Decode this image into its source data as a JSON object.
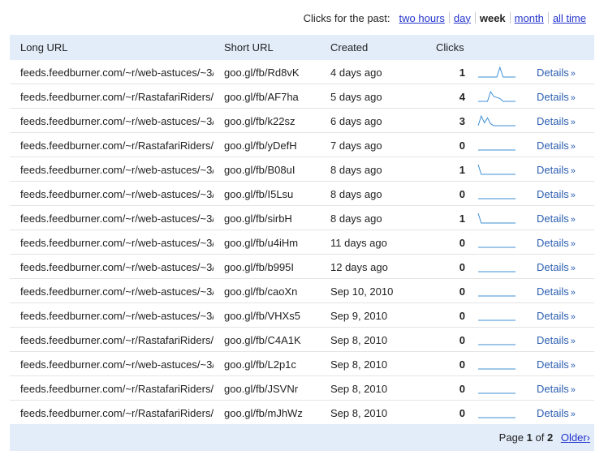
{
  "period": {
    "label": "Clicks for the past:",
    "options": [
      "two hours",
      "day",
      "week",
      "month",
      "all time"
    ],
    "selected": "week"
  },
  "columns": {
    "long_url": "Long URL",
    "short_url": "Short URL",
    "created": "Created",
    "clicks": "Clicks"
  },
  "colors": {
    "header_bg": "#e3ecf9",
    "link": "#2a5db0",
    "sparkline": "#3d8fd6"
  },
  "rows": [
    {
      "long": "feeds.feedburner.com/~r/web-astuces/~3/",
      "short": "goo.gl/fb/Rd8vK",
      "created": "4 days ago",
      "clicks": "1",
      "details": "Details",
      "spark": [
        0,
        0,
        0,
        0,
        0,
        0,
        0,
        1,
        0,
        0,
        0,
        0,
        0
      ]
    },
    {
      "long": "feeds.feedburner.com/~r/RastafariRiders/~3/",
      "short": "goo.gl/fb/AF7ha",
      "created": "5 days ago",
      "clicks": "4",
      "details": "Details",
      "spark": [
        0,
        0,
        0,
        0,
        1,
        0.5,
        0.4,
        0.3,
        0,
        0,
        0,
        0,
        0
      ]
    },
    {
      "long": "feeds.feedburner.com/~r/web-astuces/~3/",
      "short": "goo.gl/fb/k22sz",
      "created": "6 days ago",
      "clicks": "3",
      "details": "Details",
      "spark": [
        0,
        1,
        0.3,
        0.8,
        0.2,
        0,
        0,
        0,
        0,
        0,
        0,
        0,
        0
      ]
    },
    {
      "long": "feeds.feedburner.com/~r/RastafariRiders/~3/",
      "short": "goo.gl/fb/yDefH",
      "created": "7 days ago",
      "clicks": "0",
      "details": "Details",
      "spark": [
        0,
        0,
        0,
        0,
        0,
        0,
        0,
        0,
        0,
        0,
        0,
        0,
        0
      ]
    },
    {
      "long": "feeds.feedburner.com/~r/web-astuces/~3/",
      "short": "goo.gl/fb/B08uI",
      "created": "8 days ago",
      "clicks": "1",
      "details": "Details",
      "spark": [
        1,
        0,
        0,
        0,
        0,
        0,
        0,
        0,
        0,
        0,
        0,
        0,
        0
      ]
    },
    {
      "long": "feeds.feedburner.com/~r/web-astuces/~3/",
      "short": "goo.gl/fb/I5Lsu",
      "created": "8 days ago",
      "clicks": "0",
      "details": "Details",
      "spark": [
        0,
        0,
        0,
        0,
        0,
        0,
        0,
        0,
        0,
        0,
        0,
        0,
        0
      ]
    },
    {
      "long": "feeds.feedburner.com/~r/web-astuces/~3/",
      "short": "goo.gl/fb/sirbH",
      "created": "8 days ago",
      "clicks": "1",
      "details": "Details",
      "spark": [
        1,
        0,
        0,
        0,
        0,
        0,
        0,
        0,
        0,
        0,
        0,
        0,
        0
      ]
    },
    {
      "long": "feeds.feedburner.com/~r/web-astuces/~3/",
      "short": "goo.gl/fb/u4iHm",
      "created": "11 days ago",
      "clicks": "0",
      "details": "Details",
      "spark": [
        0,
        0,
        0,
        0,
        0,
        0,
        0,
        0,
        0,
        0,
        0,
        0,
        0
      ]
    },
    {
      "long": "feeds.feedburner.com/~r/web-astuces/~3/",
      "short": "goo.gl/fb/b995I",
      "created": "12 days ago",
      "clicks": "0",
      "details": "Details",
      "spark": [
        0,
        0,
        0,
        0,
        0,
        0,
        0,
        0,
        0,
        0,
        0,
        0,
        0
      ]
    },
    {
      "long": "feeds.feedburner.com/~r/web-astuces/~3/",
      "short": "goo.gl/fb/caoXn",
      "created": "Sep 10, 2010",
      "clicks": "0",
      "details": "Details",
      "spark": [
        0,
        0,
        0,
        0,
        0,
        0,
        0,
        0,
        0,
        0,
        0,
        0,
        0
      ]
    },
    {
      "long": "feeds.feedburner.com/~r/web-astuces/~3/",
      "short": "goo.gl/fb/VHXs5",
      "created": "Sep 9, 2010",
      "clicks": "0",
      "details": "Details",
      "spark": [
        0,
        0,
        0,
        0,
        0,
        0,
        0,
        0,
        0,
        0,
        0,
        0,
        0
      ]
    },
    {
      "long": "feeds.feedburner.com/~r/RastafariRiders/~3/",
      "short": "goo.gl/fb/C4A1K",
      "created": "Sep 8, 2010",
      "clicks": "0",
      "details": "Details",
      "spark": [
        0,
        0,
        0,
        0,
        0,
        0,
        0,
        0,
        0,
        0,
        0,
        0,
        0
      ]
    },
    {
      "long": "feeds.feedburner.com/~r/web-astuces/~3/",
      "short": "goo.gl/fb/L2p1c",
      "created": "Sep 8, 2010",
      "clicks": "0",
      "details": "Details",
      "spark": [
        0,
        0,
        0,
        0,
        0,
        0,
        0,
        0,
        0,
        0,
        0,
        0,
        0
      ]
    },
    {
      "long": "feeds.feedburner.com/~r/RastafariRiders/~3/",
      "short": "goo.gl/fb/JSVNr",
      "created": "Sep 8, 2010",
      "clicks": "0",
      "details": "Details",
      "spark": [
        0,
        0,
        0,
        0,
        0,
        0,
        0,
        0,
        0,
        0,
        0,
        0,
        0
      ]
    },
    {
      "long": "feeds.feedburner.com/~r/RastafariRiders/~3/",
      "short": "goo.gl/fb/mJhWz",
      "created": "Sep 8, 2010",
      "clicks": "0",
      "details": "Details",
      "spark": [
        0,
        0,
        0,
        0,
        0,
        0,
        0,
        0,
        0,
        0,
        0,
        0,
        0
      ]
    }
  ],
  "pager": {
    "page_label": "Page",
    "current": "1",
    "of_label": "of",
    "total": "2",
    "older": "Older"
  }
}
